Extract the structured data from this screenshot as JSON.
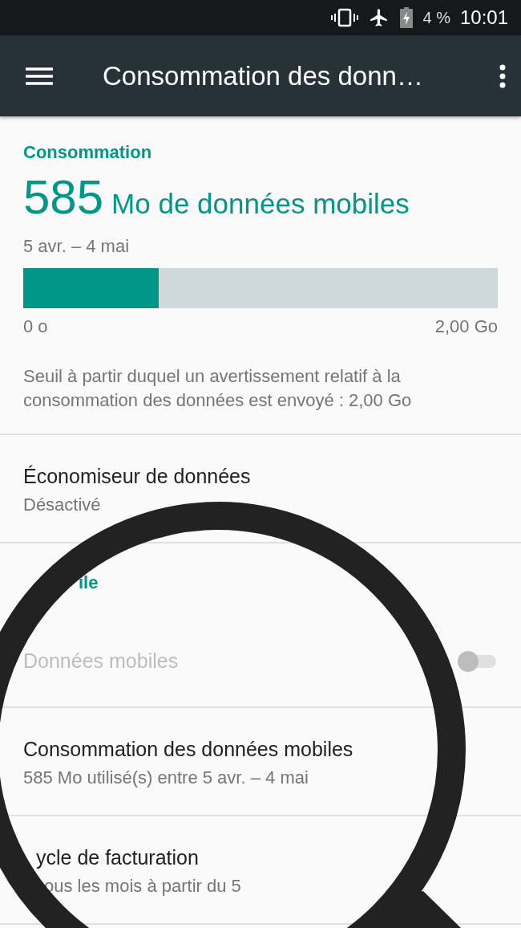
{
  "status_bar": {
    "battery": "4 %",
    "time": "10:01"
  },
  "toolbar": {
    "title": "Consommation des donn…"
  },
  "usage": {
    "header": "Consommation",
    "amount": "585",
    "unit": "Mo de données mobiles",
    "period": "5 avr. – 4 mai",
    "level": 0.285,
    "min_label": "0 o",
    "max_label": "2,00 Go",
    "warning": "Seuil à partir duquel un avertissement relatif à la consommation des données est envoyé : 2,00 Go"
  },
  "data_saver": {
    "title": "Économiseur de données",
    "summary": "Désactivé"
  },
  "mobile_section": {
    "header": "ile",
    "items": [
      {
        "kind": "switch",
        "title": "Données mobiles",
        "disabled": true,
        "on": false
      },
      {
        "kind": "text",
        "title": "Consommation des données mobiles",
        "summary": "585 Mo utilisé(s) entre 5 avr. – 4 mai"
      },
      {
        "kind": "cut",
        "title": "ycle de facturation",
        "summary": "ous les mois à partir du 5"
      }
    ]
  }
}
